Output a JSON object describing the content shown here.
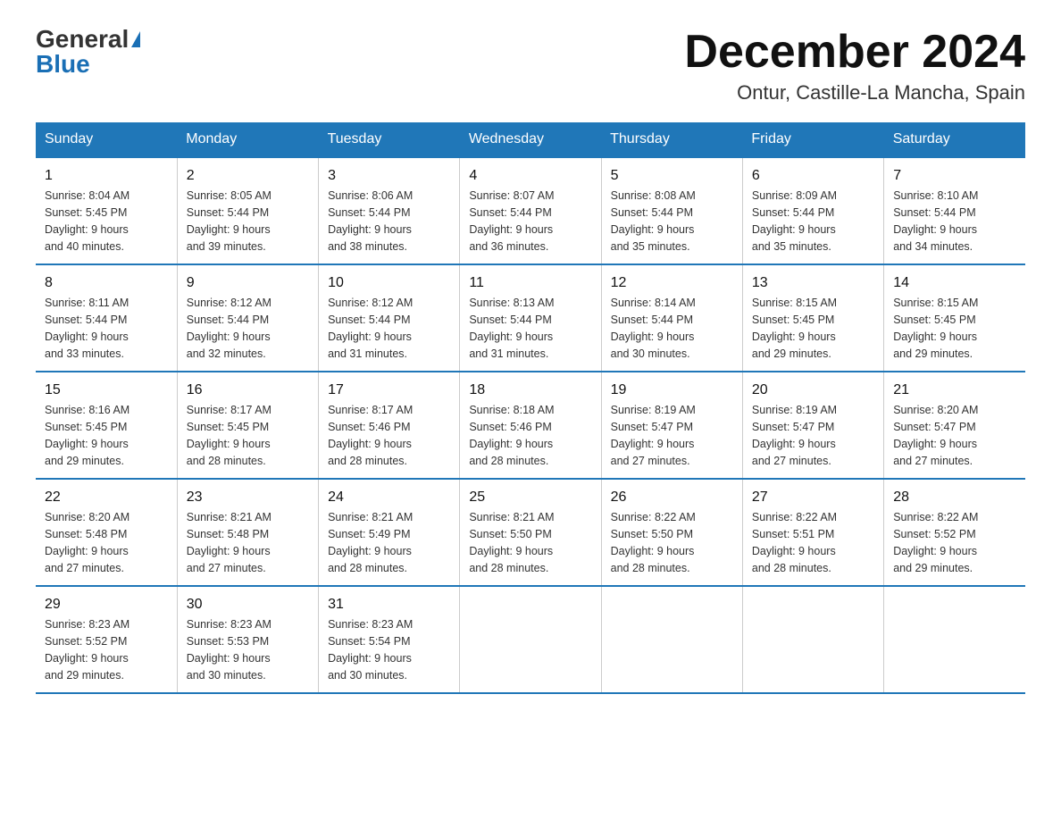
{
  "logo": {
    "general": "General",
    "blue": "Blue",
    "triangle": true
  },
  "header": {
    "month_year": "December 2024",
    "location": "Ontur, Castille-La Mancha, Spain"
  },
  "days_of_week": [
    "Sunday",
    "Monday",
    "Tuesday",
    "Wednesday",
    "Thursday",
    "Friday",
    "Saturday"
  ],
  "weeks": [
    [
      {
        "day": "1",
        "sunrise": "8:04 AM",
        "sunset": "5:45 PM",
        "daylight": "9 hours and 40 minutes."
      },
      {
        "day": "2",
        "sunrise": "8:05 AM",
        "sunset": "5:44 PM",
        "daylight": "9 hours and 39 minutes."
      },
      {
        "day": "3",
        "sunrise": "8:06 AM",
        "sunset": "5:44 PM",
        "daylight": "9 hours and 38 minutes."
      },
      {
        "day": "4",
        "sunrise": "8:07 AM",
        "sunset": "5:44 PM",
        "daylight": "9 hours and 36 minutes."
      },
      {
        "day": "5",
        "sunrise": "8:08 AM",
        "sunset": "5:44 PM",
        "daylight": "9 hours and 35 minutes."
      },
      {
        "day": "6",
        "sunrise": "8:09 AM",
        "sunset": "5:44 PM",
        "daylight": "9 hours and 35 minutes."
      },
      {
        "day": "7",
        "sunrise": "8:10 AM",
        "sunset": "5:44 PM",
        "daylight": "9 hours and 34 minutes."
      }
    ],
    [
      {
        "day": "8",
        "sunrise": "8:11 AM",
        "sunset": "5:44 PM",
        "daylight": "9 hours and 33 minutes."
      },
      {
        "day": "9",
        "sunrise": "8:12 AM",
        "sunset": "5:44 PM",
        "daylight": "9 hours and 32 minutes."
      },
      {
        "day": "10",
        "sunrise": "8:12 AM",
        "sunset": "5:44 PM",
        "daylight": "9 hours and 31 minutes."
      },
      {
        "day": "11",
        "sunrise": "8:13 AM",
        "sunset": "5:44 PM",
        "daylight": "9 hours and 31 minutes."
      },
      {
        "day": "12",
        "sunrise": "8:14 AM",
        "sunset": "5:44 PM",
        "daylight": "9 hours and 30 minutes."
      },
      {
        "day": "13",
        "sunrise": "8:15 AM",
        "sunset": "5:45 PM",
        "daylight": "9 hours and 29 minutes."
      },
      {
        "day": "14",
        "sunrise": "8:15 AM",
        "sunset": "5:45 PM",
        "daylight": "9 hours and 29 minutes."
      }
    ],
    [
      {
        "day": "15",
        "sunrise": "8:16 AM",
        "sunset": "5:45 PM",
        "daylight": "9 hours and 29 minutes."
      },
      {
        "day": "16",
        "sunrise": "8:17 AM",
        "sunset": "5:45 PM",
        "daylight": "9 hours and 28 minutes."
      },
      {
        "day": "17",
        "sunrise": "8:17 AM",
        "sunset": "5:46 PM",
        "daylight": "9 hours and 28 minutes."
      },
      {
        "day": "18",
        "sunrise": "8:18 AM",
        "sunset": "5:46 PM",
        "daylight": "9 hours and 28 minutes."
      },
      {
        "day": "19",
        "sunrise": "8:19 AM",
        "sunset": "5:47 PM",
        "daylight": "9 hours and 27 minutes."
      },
      {
        "day": "20",
        "sunrise": "8:19 AM",
        "sunset": "5:47 PM",
        "daylight": "9 hours and 27 minutes."
      },
      {
        "day": "21",
        "sunrise": "8:20 AM",
        "sunset": "5:47 PM",
        "daylight": "9 hours and 27 minutes."
      }
    ],
    [
      {
        "day": "22",
        "sunrise": "8:20 AM",
        "sunset": "5:48 PM",
        "daylight": "9 hours and 27 minutes."
      },
      {
        "day": "23",
        "sunrise": "8:21 AM",
        "sunset": "5:48 PM",
        "daylight": "9 hours and 27 minutes."
      },
      {
        "day": "24",
        "sunrise": "8:21 AM",
        "sunset": "5:49 PM",
        "daylight": "9 hours and 28 minutes."
      },
      {
        "day": "25",
        "sunrise": "8:21 AM",
        "sunset": "5:50 PM",
        "daylight": "9 hours and 28 minutes."
      },
      {
        "day": "26",
        "sunrise": "8:22 AM",
        "sunset": "5:50 PM",
        "daylight": "9 hours and 28 minutes."
      },
      {
        "day": "27",
        "sunrise": "8:22 AM",
        "sunset": "5:51 PM",
        "daylight": "9 hours and 28 minutes."
      },
      {
        "day": "28",
        "sunrise": "8:22 AM",
        "sunset": "5:52 PM",
        "daylight": "9 hours and 29 minutes."
      }
    ],
    [
      {
        "day": "29",
        "sunrise": "8:23 AM",
        "sunset": "5:52 PM",
        "daylight": "9 hours and 29 minutes."
      },
      {
        "day": "30",
        "sunrise": "8:23 AM",
        "sunset": "5:53 PM",
        "daylight": "9 hours and 30 minutes."
      },
      {
        "day": "31",
        "sunrise": "8:23 AM",
        "sunset": "5:54 PM",
        "daylight": "9 hours and 30 minutes."
      },
      {
        "day": "",
        "sunrise": "",
        "sunset": "",
        "daylight": ""
      },
      {
        "day": "",
        "sunrise": "",
        "sunset": "",
        "daylight": ""
      },
      {
        "day": "",
        "sunrise": "",
        "sunset": "",
        "daylight": ""
      },
      {
        "day": "",
        "sunrise": "",
        "sunset": "",
        "daylight": ""
      }
    ]
  ]
}
